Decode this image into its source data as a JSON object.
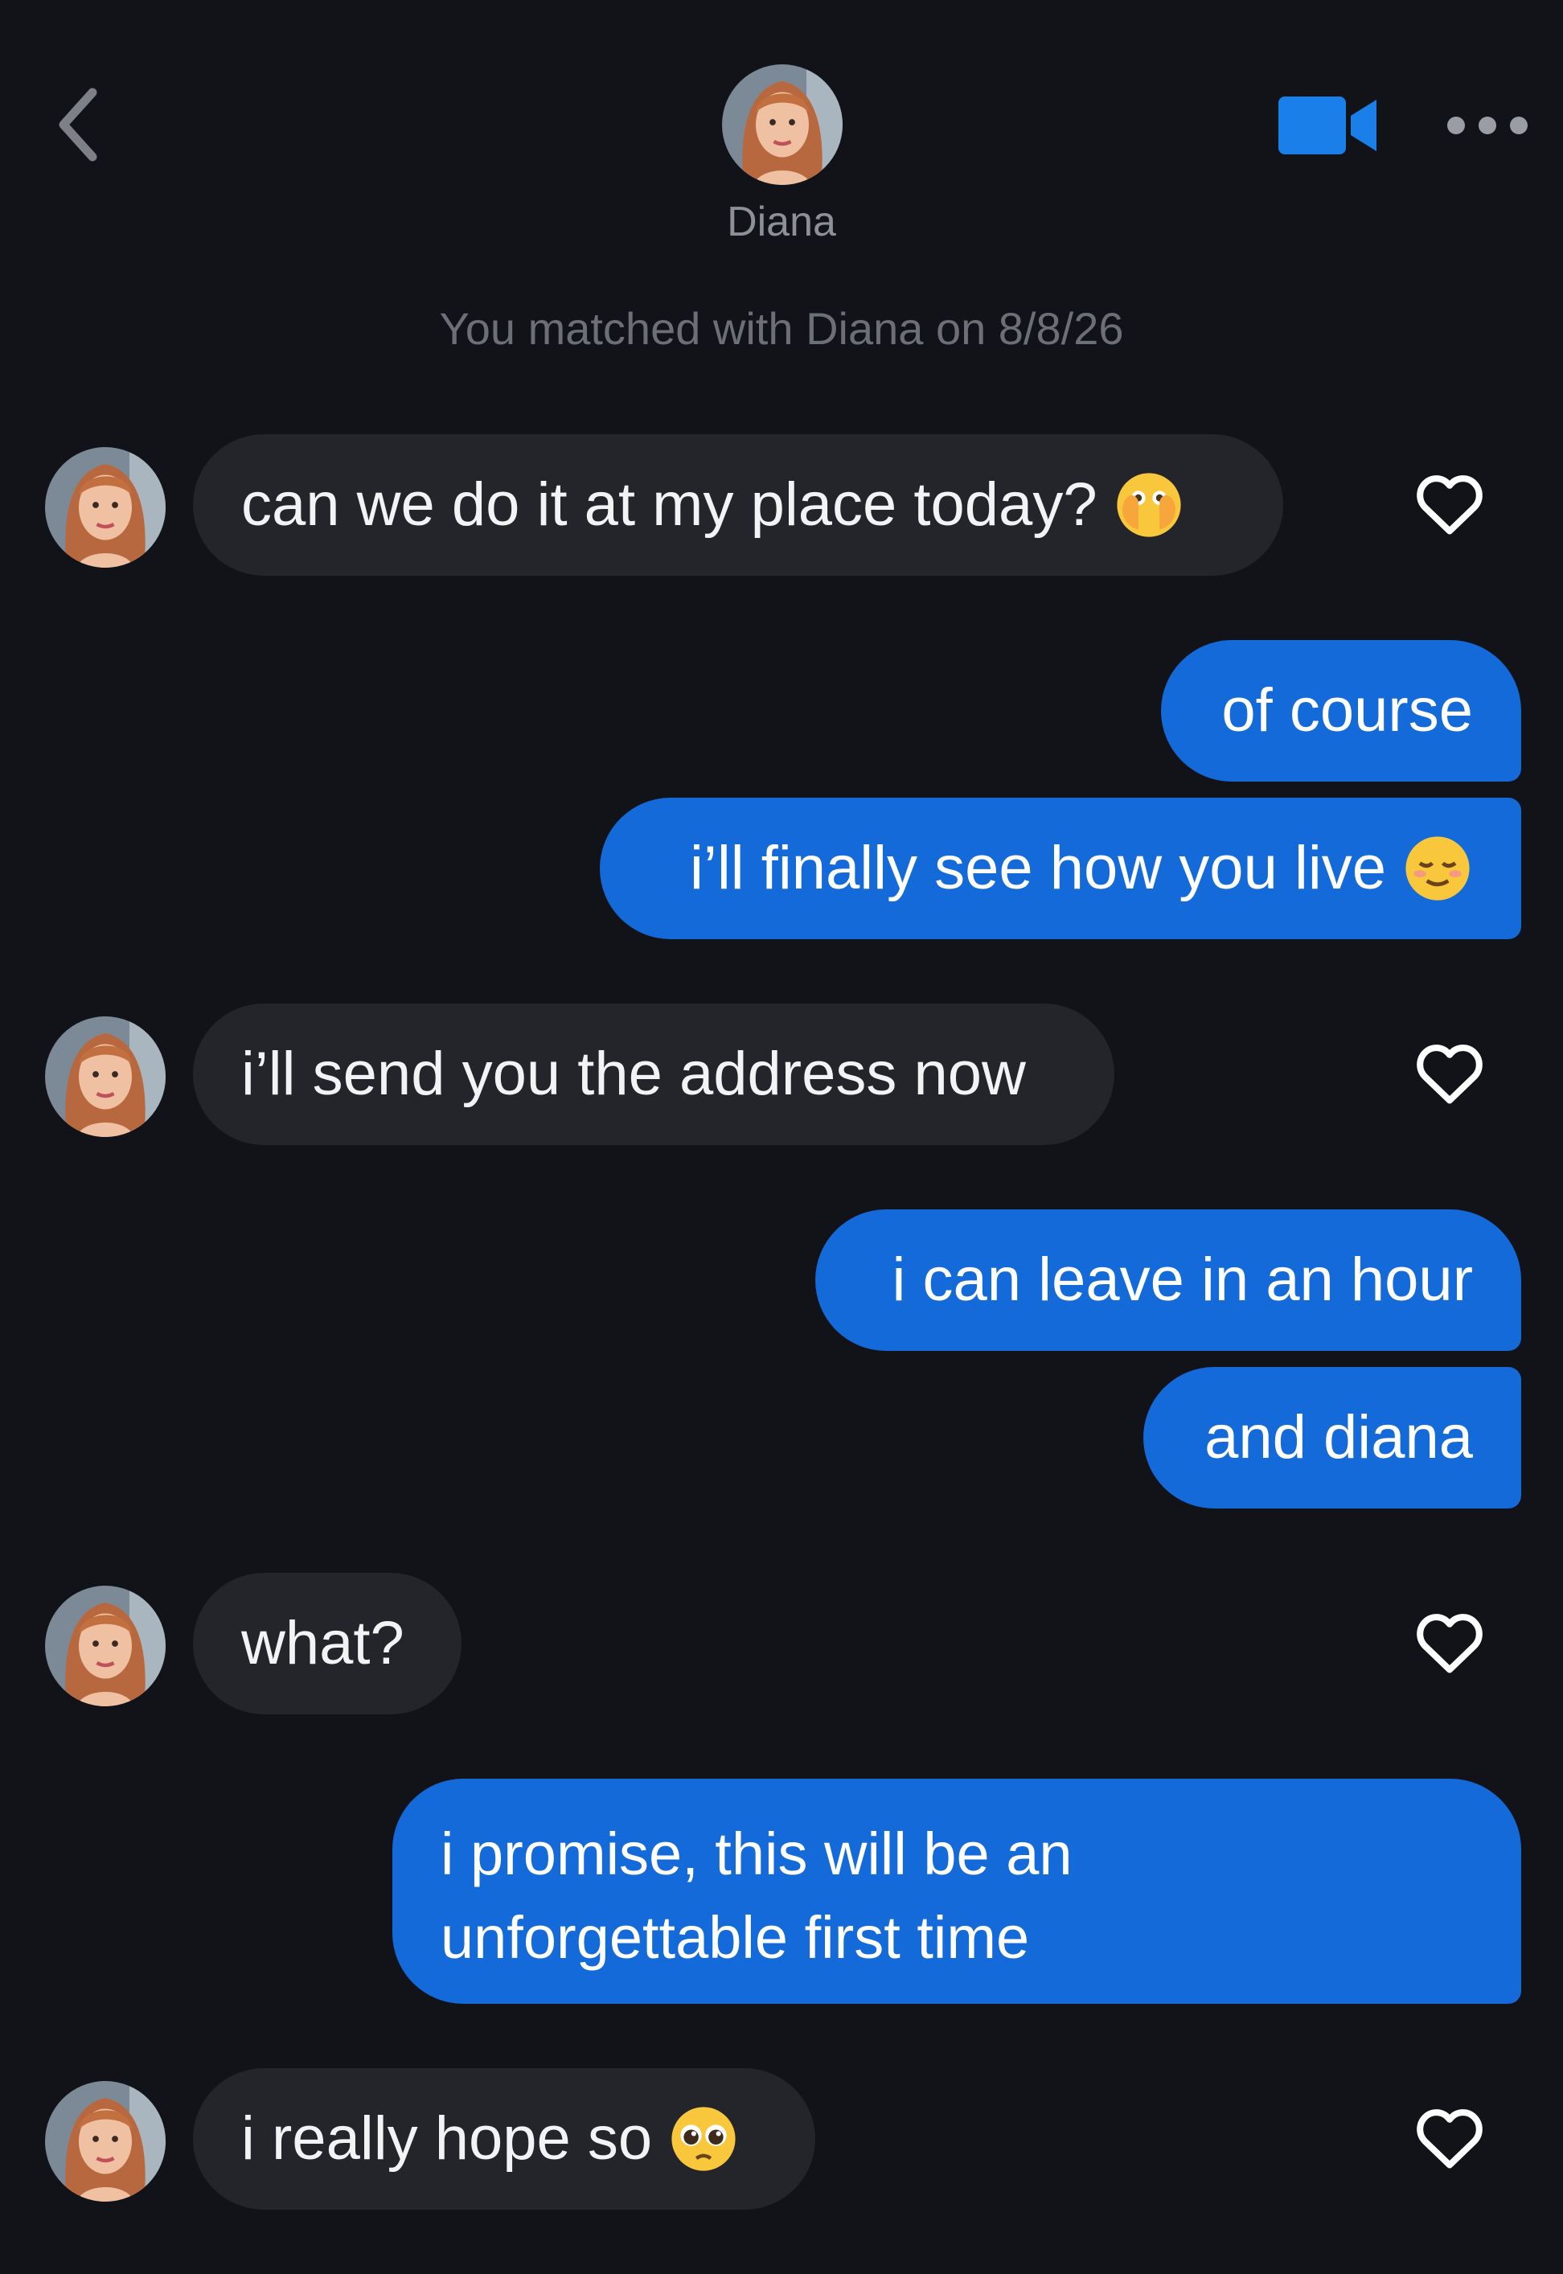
{
  "header": {
    "name": "Diana",
    "back_icon": "chevron-left-icon",
    "video_icon": "video-camera-icon",
    "more_icon": "more-dots-icon",
    "accent_color": "#1a7fe8"
  },
  "match_note": "You matched with Diana on 8/8/26",
  "messages": [
    {
      "from": "them",
      "text": "can we do it at my place today?",
      "emoji": "face-with-open-eyes-and-hand-over-mouth"
    },
    {
      "from": "me",
      "text": "of course"
    },
    {
      "from": "me",
      "text": "i’ll finally see how you live",
      "emoji": "relieved-face"
    },
    {
      "from": "them",
      "text": "i’ll send you the address now"
    },
    {
      "from": "me",
      "text": "i can leave in an hour"
    },
    {
      "from": "me",
      "text": "and diana"
    },
    {
      "from": "them",
      "text": "what?"
    },
    {
      "from": "me",
      "text": "i promise, this will be an unforgettable first time"
    },
    {
      "from": "them",
      "text": "i really hope so",
      "emoji": "pleading-face"
    }
  ],
  "colors": {
    "background": "#111318",
    "incoming_bubble": "#23252b",
    "outgoing_bubble": "#136ad8"
  }
}
